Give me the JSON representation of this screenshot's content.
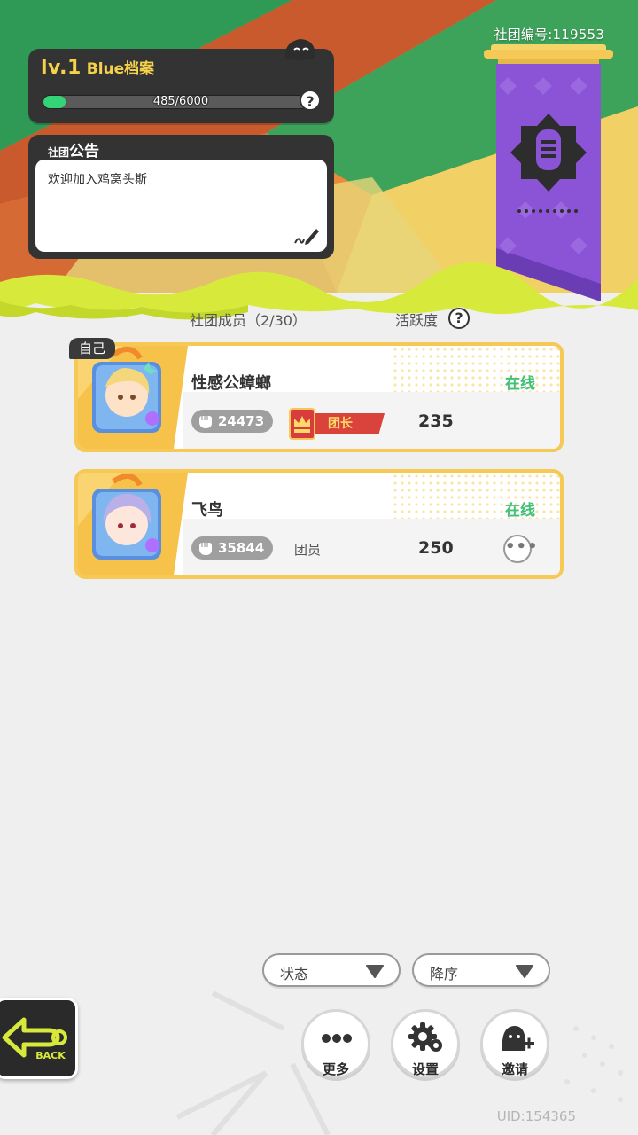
{
  "colors": {
    "accent_yellow": "#f6c956",
    "online_green": "#43c077",
    "xp_green": "#35d377",
    "panel_dark": "#333333",
    "banner_purple": "#8b54d6"
  },
  "header": {
    "club_id": "社团编号:119553"
  },
  "level": {
    "level_text": "lv.1",
    "club_name": "Blue档案",
    "xp_text": "485/6000",
    "xp_fraction": 0.081,
    "help_glyph": "?"
  },
  "notice": {
    "header_small": "社团",
    "header_big": "公告",
    "content": "欢迎加入鸡窝头斯"
  },
  "members": {
    "label": "社团成员（2/30）",
    "activity_label": "活跃度",
    "help_glyph": "?",
    "self_tag": "自己",
    "list": [
      {
        "name": "性感公蟑螂",
        "status": "在线",
        "power": "24473",
        "role": "团长",
        "activity": "235"
      },
      {
        "name": "飞鸟",
        "status": "在线",
        "power": "35844",
        "role": "团员",
        "activity": "250",
        "more_glyph": "•••"
      }
    ]
  },
  "filters": {
    "status_label": "状态",
    "order_label": "降序"
  },
  "actions": {
    "more_label": "更多",
    "settings_label": "设置",
    "invite_label": "邀请"
  },
  "back": {
    "label": "BACK"
  },
  "uid": "UID:154365",
  "icons": [
    "blob-icon",
    "help-icon",
    "edit-icon",
    "club-emblem-icon",
    "fist-icon",
    "crown-icon",
    "chevron-down-icon",
    "more-icon",
    "gear-icon",
    "invite-user-icon",
    "back-arrow-icon"
  ]
}
